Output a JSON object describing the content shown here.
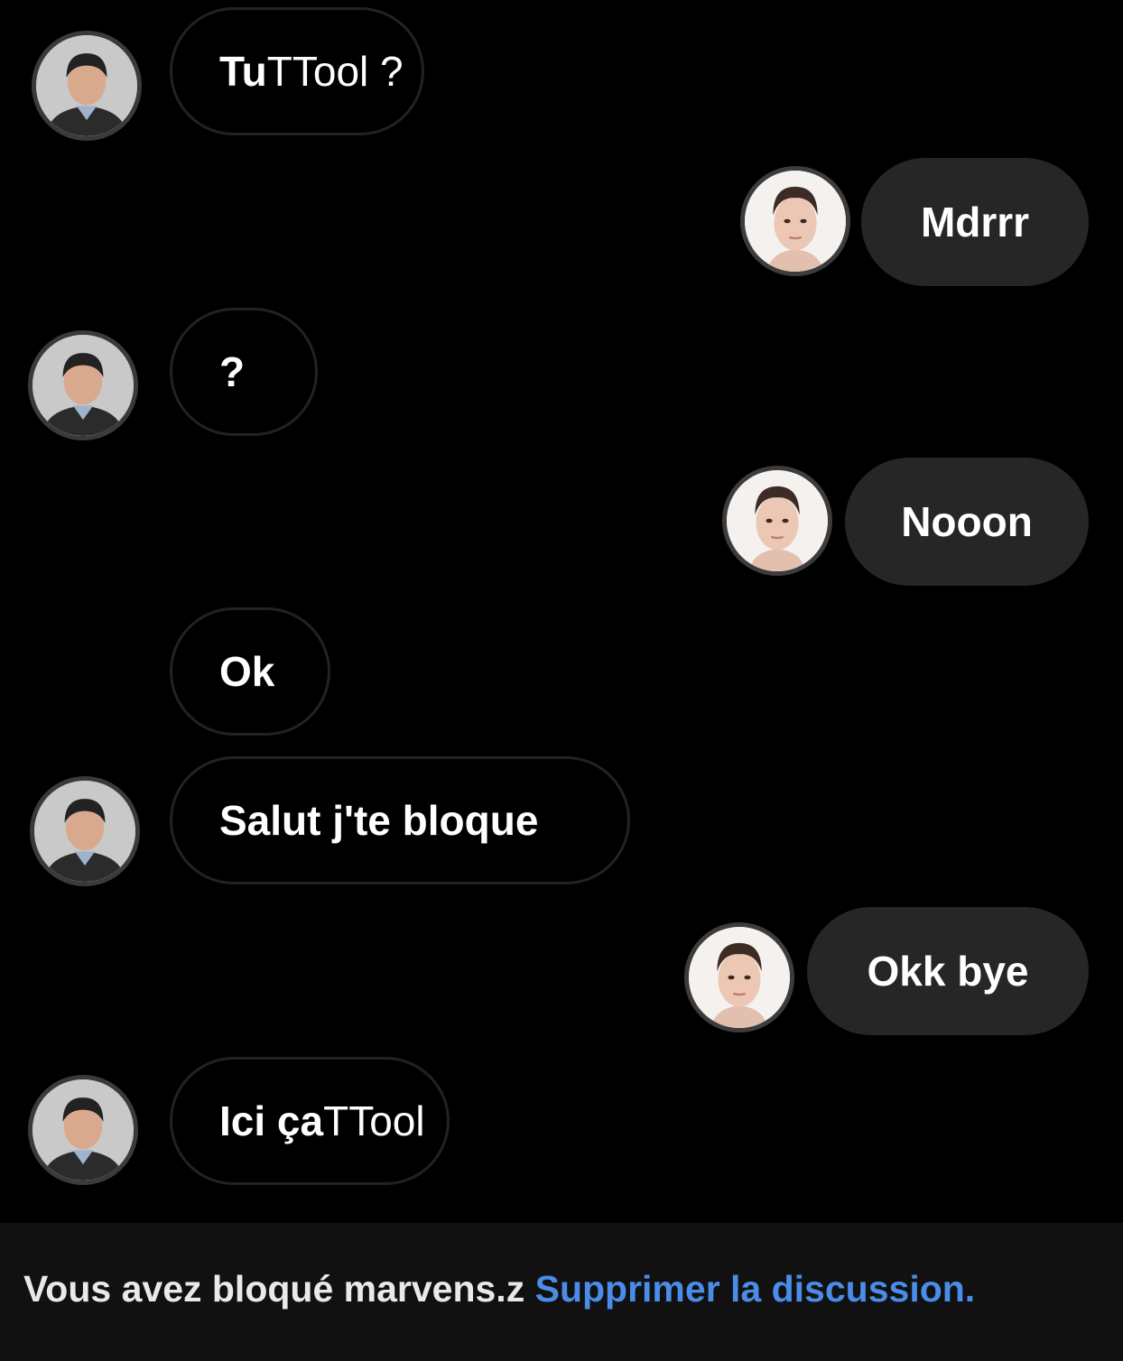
{
  "messages": [
    {
      "sender": "them",
      "text": "Tu",
      "text_suffix": "TTool ?"
    },
    {
      "sender": "me",
      "text": "Mdrrr"
    },
    {
      "sender": "them",
      "text": "?"
    },
    {
      "sender": "me",
      "text": "Nooon"
    },
    {
      "sender": "them",
      "text": "Ok"
    },
    {
      "sender": "them",
      "text": "Salut j'te bloque"
    },
    {
      "sender": "me",
      "text": "Okk bye"
    },
    {
      "sender": "them",
      "text": "Ici ça",
      "text_suffix": "TTool"
    }
  ],
  "footer": {
    "blocked_text": "Vous avez bloqué marvens.z",
    "delete_link": "Supprimer la discussion."
  },
  "colors": {
    "background": "#000000",
    "outgoing_bubble": "#262626",
    "incoming_bubble_border": "#222222",
    "link": "#4a8ce8"
  }
}
